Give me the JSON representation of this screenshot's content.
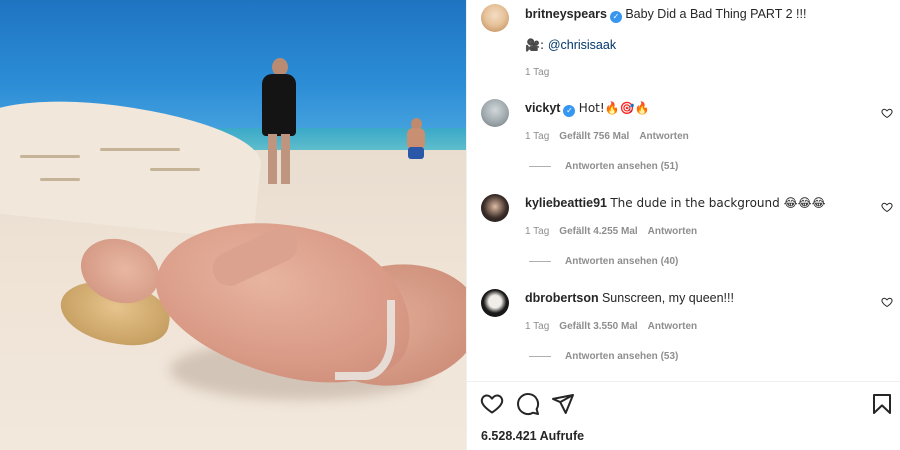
{
  "post": {
    "author": "britneyspears",
    "verified": true,
    "caption": "Baby Did a Bad Thing PART 2 !!!",
    "credit_prefix": "🎥: ",
    "credit_mention": "@chrisisaak",
    "time": "1 Tag"
  },
  "comments": [
    {
      "user": "vickyt",
      "verified": true,
      "text": "Hot!🔥🎯🔥",
      "time": "1 Tag",
      "likes": "Gefällt 756 Mal",
      "reply": "Antworten",
      "view_replies": "Antworten ansehen (51)"
    },
    {
      "user": "kyliebeattie91",
      "verified": false,
      "text": "The dude in the background 😂😂😂",
      "time": "1 Tag",
      "likes": "Gefällt 4.255 Mal",
      "reply": "Antworten",
      "view_replies": "Antworten ansehen (40)"
    },
    {
      "user": "dbrobertson",
      "verified": false,
      "text": "Sunscreen, my queen!!!",
      "time": "1 Tag",
      "likes": "Gefällt 3.550 Mal",
      "reply": "Antworten",
      "view_replies": "Antworten ansehen (53)"
    }
  ],
  "actions": {
    "icons": [
      "heart-icon",
      "comment-icon",
      "share-icon",
      "bookmark-icon"
    ]
  },
  "views": "6.528.421 Aufrufe",
  "colors": {
    "text": "#262626",
    "meta": "#8e8e8e",
    "verified": "#3797f0",
    "mention": "#00376b"
  }
}
